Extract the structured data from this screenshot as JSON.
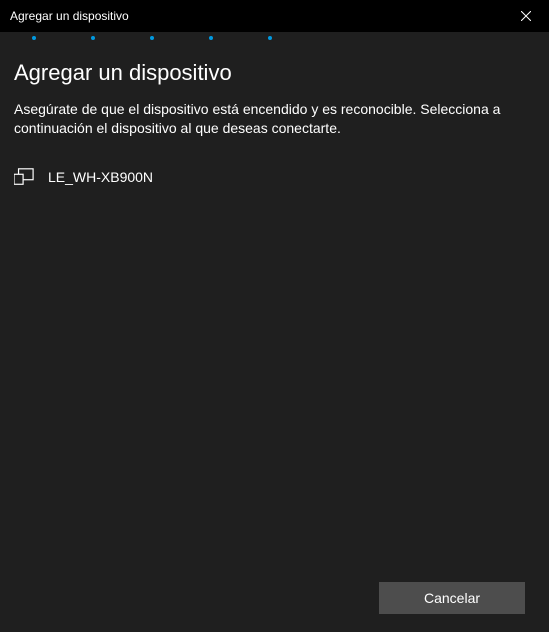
{
  "titlebar": {
    "title": "Agregar un dispositivo"
  },
  "heading": "Agregar un dispositivo",
  "instruction": "Asegúrate de que el dispositivo está encendido y es reconocible. Selecciona a continuación el dispositivo al que deseas conectarte.",
  "devices": [
    {
      "name": "LE_WH-XB900N"
    }
  ],
  "footer": {
    "cancel_label": "Cancelar"
  }
}
